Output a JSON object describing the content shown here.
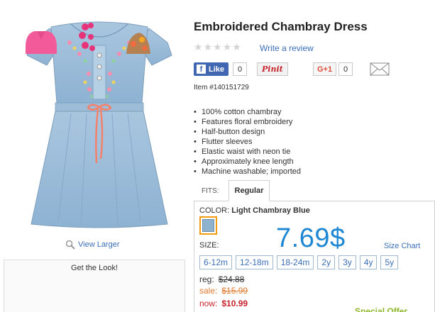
{
  "product": {
    "title": "Embroidered Chambray Dress",
    "item_number": "Item #140151729",
    "rating_stars": 0,
    "rating_max": 5,
    "write_review_label": "Write a review",
    "view_larger_label": "View Larger",
    "features": [
      "100% cotton chambray",
      "Features floral embroidery",
      "Half-button design",
      "Flutter sleeves",
      "Elastic waist with neon tie",
      "Approximately knee length",
      "Machine washable; imported"
    ]
  },
  "social": {
    "facebook_label": "Like",
    "facebook_count": "0",
    "pinterest_label": "Pinit",
    "gplus_label": "G+1",
    "gplus_count": "0",
    "email_icon": "envelope-icon"
  },
  "get_the_look": {
    "title": "Get the Look!"
  },
  "tabs": {
    "fits_label": "FITS:",
    "active_tab": "Regular"
  },
  "options": {
    "color_label": "COLOR:",
    "color_value": "Light Chambray Blue",
    "big_price": "7.69$",
    "size_label": "SIZE:",
    "size_chart_label": "Size Chart",
    "sizes": [
      "6-12m",
      "12-18m",
      "18-24m",
      "2y",
      "3y",
      "4y",
      "5y"
    ]
  },
  "pricing": {
    "reg_label": "reg:",
    "reg_value": "$24.88",
    "sale_label": "sale:",
    "sale_value": "$15.99",
    "now_label": "now:",
    "now_value": "$10.99",
    "special_offer": "Special Offer"
  },
  "colors": {
    "link": "#3b6fb6",
    "price_blue": "#1e87d4",
    "sale_orange": "#e07a2e",
    "now_red": "#c8232c",
    "facebook": "#4267b2",
    "swatch": "#8fb3cf",
    "swatch_border": "#f39c12",
    "offer_green": "#8fb92b"
  }
}
